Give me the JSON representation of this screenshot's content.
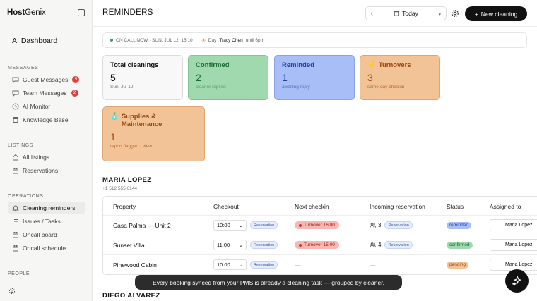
{
  "brand": {
    "bold": "Host",
    "light": "Genix"
  },
  "sidebar": {
    "dashboard_title": "AI Dashboard",
    "sections": [
      {
        "label": "MESSAGES",
        "items": [
          {
            "label": "Guest Messages",
            "icon": "chat-icon",
            "badge": "5"
          },
          {
            "label": "Team Messages",
            "icon": "chat-icon",
            "badge": "2"
          },
          {
            "label": "AI Monitor",
            "icon": "clock-icon"
          },
          {
            "label": "Knowledge Base",
            "icon": "book-icon"
          }
        ]
      },
      {
        "label": "LISTINGS",
        "items": [
          {
            "label": "All listings",
            "icon": "home-icon"
          },
          {
            "label": "Reservations",
            "icon": "calendar-icon"
          }
        ]
      },
      {
        "label": "OPERATIONS",
        "items": [
          {
            "label": "Cleaning reminders",
            "icon": "bell-icon",
            "active": true
          },
          {
            "label": "Issues / Tasks",
            "icon": "list-icon"
          },
          {
            "label": "Oncall board",
            "icon": "calendar-icon"
          },
          {
            "label": "Oncall schedule",
            "icon": "calendar-icon"
          }
        ]
      },
      {
        "label": "PEOPLE",
        "items": []
      }
    ]
  },
  "header": {
    "title": "REMINDERS",
    "date_label": "Today",
    "new_button": "New cleaning"
  },
  "oncall": {
    "label": "ON CALL NOW · SUN, JUL 12, 15:10",
    "shift": "Day",
    "person": "Tracy Chen",
    "until": "until 6pm"
  },
  "cards": {
    "total": {
      "title": "Total cleanings",
      "value": "5",
      "sub": "Sun, Jul 12"
    },
    "confirmed": {
      "title": "Confirmed",
      "value": "2",
      "sub": "cleaner replied"
    },
    "reminded": {
      "title": "Reminded",
      "value": "1",
      "sub": "awaiting reply"
    },
    "turnovers": {
      "title": "Turnovers",
      "value": "3",
      "sub": "same-day checkin"
    },
    "supplies": {
      "title": "Supplies & Maintenance",
      "value": "1",
      "sub": "report flagged · view"
    }
  },
  "cleaner1": {
    "name": "MARIA LOPEZ",
    "phone": "+1 512 555 0144",
    "columns": [
      "Property",
      "Checkout",
      "Next checkin",
      "Incoming reservation",
      "Status",
      "Assigned to"
    ],
    "rows": [
      {
        "property": "Casa Palma — Unit 2",
        "checkout": "10:00",
        "checkout_tag": "Reservation",
        "next_checkin": "Turnover 16:00",
        "guests": "3",
        "incoming_tag": "Reservation",
        "status": "reminded",
        "assigned": "Maria Lopez"
      },
      {
        "property": "Sunset Villa",
        "checkout": "11:00",
        "checkout_tag": "Reservation",
        "next_checkin": "Turnover 15:00",
        "guests": "4",
        "incoming_tag": "Reservation",
        "status": "confirmed",
        "assigned": "Maria Lopez"
      },
      {
        "property": "Pinewood Cabin",
        "checkout": "10:00",
        "checkout_tag": "Reservation",
        "next_checkin": "—",
        "guests": "",
        "incoming_tag": "—",
        "status": "pending",
        "assigned": "Maria Lopez"
      }
    ]
  },
  "cleaner2": {
    "name": "DIEGO ALVAREZ"
  },
  "toast": "Every booking synced from your PMS is already a cleaning task — grouped by cleaner.",
  "colors": {
    "confirmed": "#9fd9ad",
    "reminded": "#a7bef7",
    "turnovers": "#f1c396",
    "danger": "#e23d3d"
  }
}
